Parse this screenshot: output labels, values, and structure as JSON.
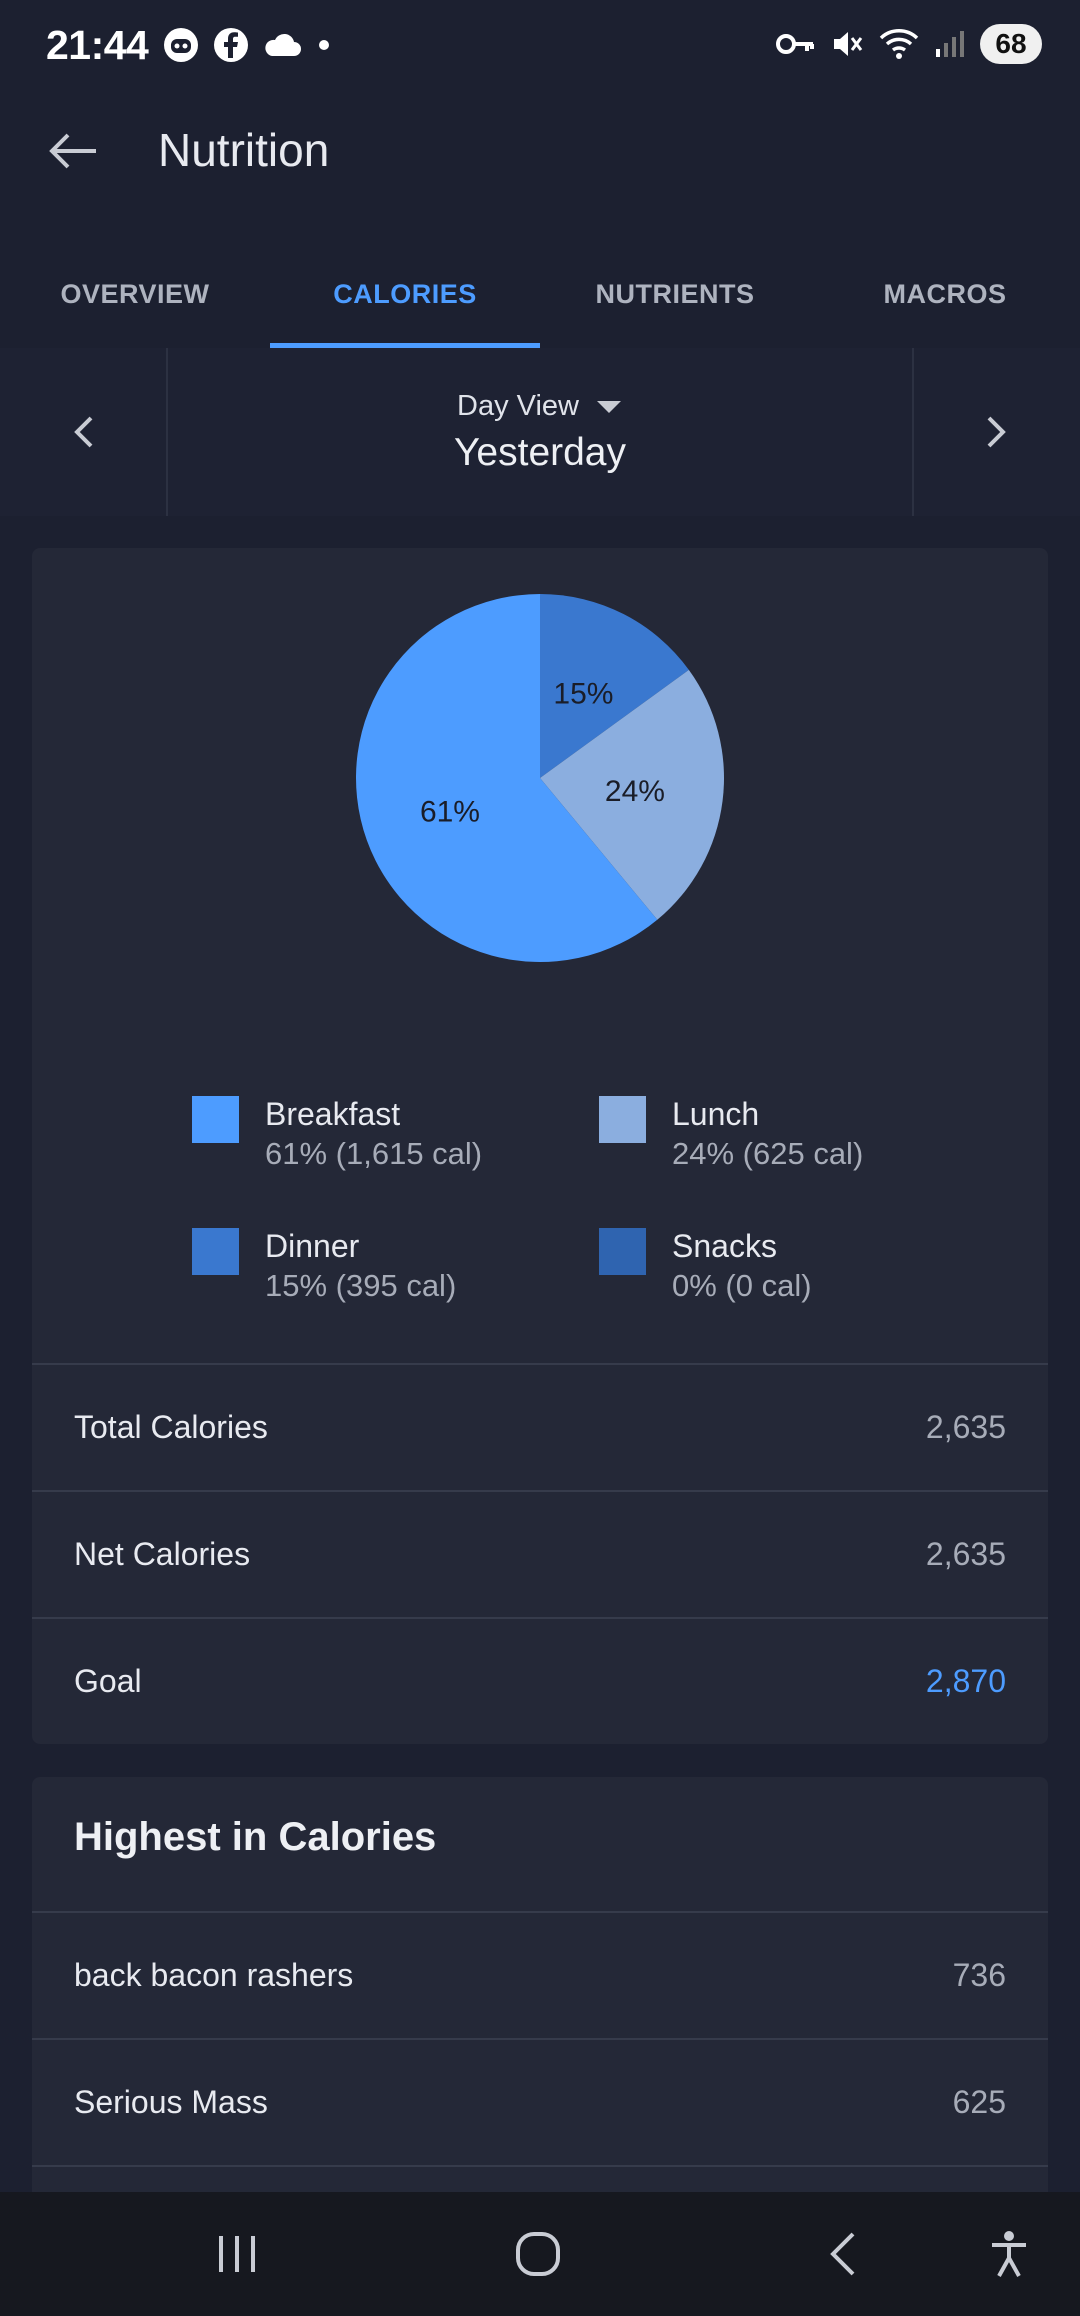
{
  "status_bar": {
    "time": "21:44",
    "left_icons": [
      "robot-icon",
      "facebook-icon",
      "cloud-icon",
      "dot-icon"
    ],
    "right_icons": [
      "key-icon",
      "mute-icon",
      "wifi-icon",
      "signal-icon"
    ],
    "battery": "68"
  },
  "app_bar": {
    "title": "Nutrition",
    "back_icon": "arrow-left-icon"
  },
  "tabs": [
    {
      "label": "OVERVIEW",
      "active": false
    },
    {
      "label": "CALORIES",
      "active": true
    },
    {
      "label": "NUTRIENTS",
      "active": false
    },
    {
      "label": "MACROS",
      "active": false
    }
  ],
  "date_nav": {
    "view_label": "Day View",
    "date_label": "Yesterday"
  },
  "chart_data": {
    "type": "pie",
    "title": "",
    "slices": [
      {
        "name": "Breakfast",
        "percent": 61,
        "calories": 1615,
        "color": "#4d9cff",
        "label": "61%"
      },
      {
        "name": "Lunch",
        "percent": 24,
        "calories": 625,
        "color": "#8baedf",
        "label": "24%"
      },
      {
        "name": "Dinner",
        "percent": 15,
        "calories": 395,
        "color": "#3a78cf",
        "label": "15%"
      },
      {
        "name": "Snacks",
        "percent": 0,
        "calories": 0,
        "color": "#2f64b0",
        "label": ""
      }
    ],
    "legend_placement": "bottom"
  },
  "legend": [
    {
      "name": "Breakfast",
      "value": "61% (1,615 cal)"
    },
    {
      "name": "Lunch",
      "value": "24% (625 cal)"
    },
    {
      "name": "Dinner",
      "value": "15% (395 cal)"
    },
    {
      "name": "Snacks",
      "value": "0% (0 cal)"
    }
  ],
  "summary": {
    "total_label": "Total Calories",
    "total_value": "2,635",
    "net_label": "Net Calories",
    "net_value": "2,635",
    "goal_label": "Goal",
    "goal_value": "2,870"
  },
  "highest": {
    "title": "Highest in Calories",
    "items": [
      {
        "name": "back bacon rashers",
        "value": "736"
      },
      {
        "name": "Serious Mass",
        "value": "625"
      }
    ]
  },
  "colors": {
    "accent": "#4d9cff",
    "background": "#1c2030",
    "card": "#242837"
  }
}
